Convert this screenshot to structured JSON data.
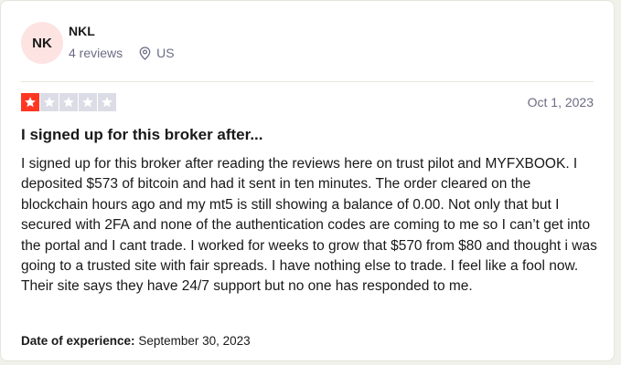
{
  "reviewer": {
    "initials": "NK",
    "name": "NKL",
    "reviews_count": "4 reviews",
    "country": "US",
    "avatar_color": "#fde3e1"
  },
  "review": {
    "rating": 1,
    "max_rating": 5,
    "star_color": "#ff3722",
    "date": "Oct 1, 2023",
    "title": "I signed up for this broker after...",
    "body": "I signed up for this broker after reading the reviews here on trust pilot and MYFXBOOK. I deposited $573 of bitcoin and had it sent in ten minutes. The order cleared on the blockchain hours ago and my mt5 is still showing a balance of 0.00. Not only that but I secured with 2FA and none of the authentication codes are coming to me so I can’t get into the portal and I cant trade. I worked for weeks to grow that $570 from $80 and thought i was going to a trusted site with fair spreads. I have nothing else to trade. I feel like a fool now. Their site says they have 24/7 support but no one has responded to me.",
    "experience_label": "Date of experience:",
    "experience_date": "September 30, 2023"
  },
  "icons": {
    "location": "location-pin-icon",
    "star": "star-icon"
  }
}
